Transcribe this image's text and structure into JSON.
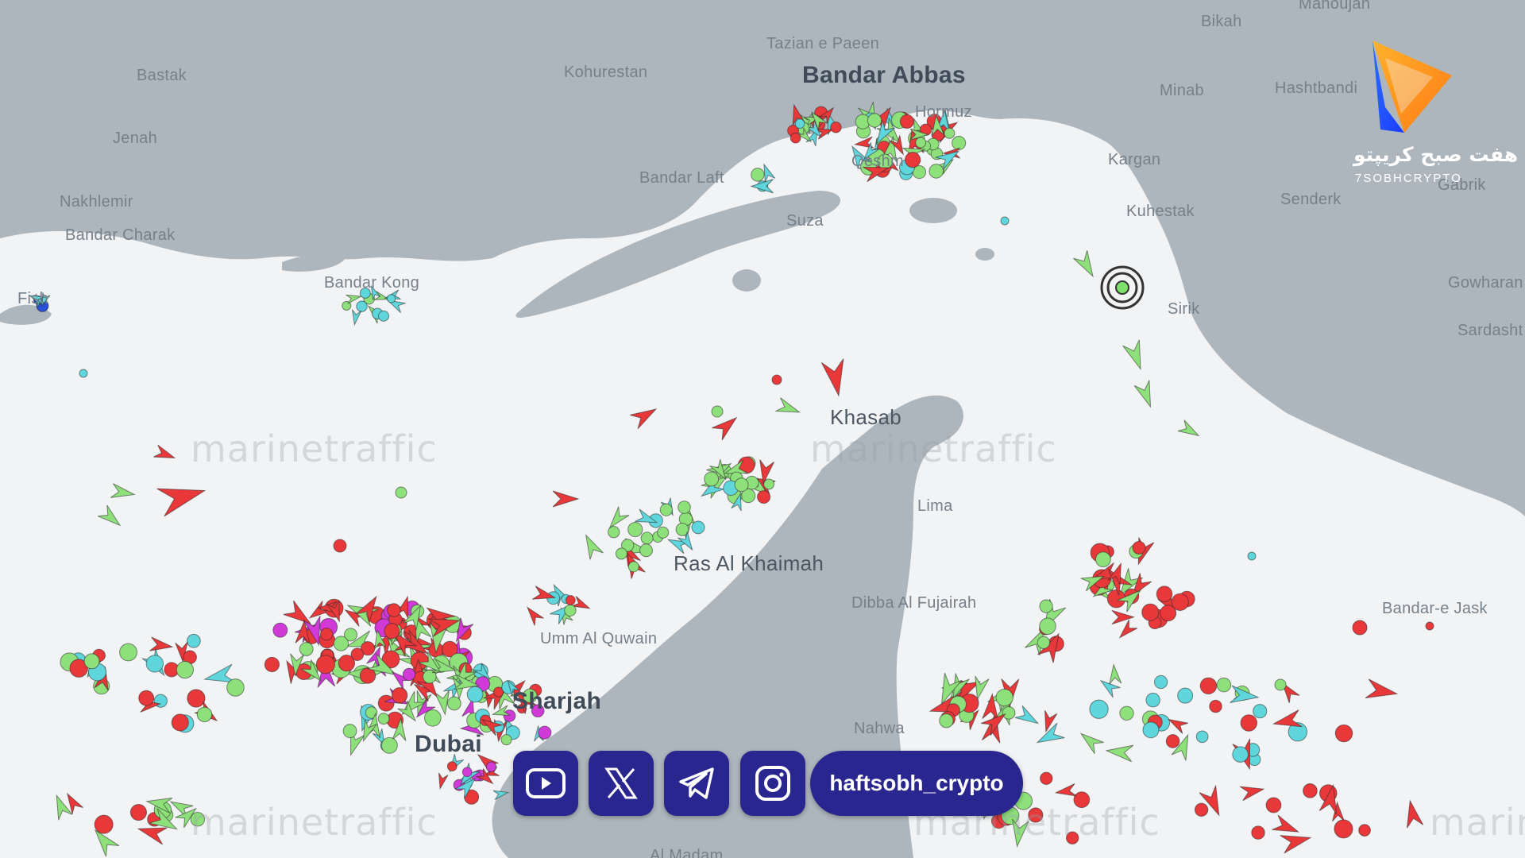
{
  "map": {
    "labels": [
      {
        "id": "bandar-abbas",
        "text": "Bandar Abbas"
      },
      {
        "id": "hormuz",
        "text": "Hormuz"
      },
      {
        "id": "tazian",
        "text": "Tazian e Paeen"
      },
      {
        "id": "kohurestan",
        "text": "Kohurestan"
      },
      {
        "id": "bastak",
        "text": "Bastak"
      },
      {
        "id": "jenah",
        "text": "Jenah"
      },
      {
        "id": "nakhlemir",
        "text": "Nakhlemir"
      },
      {
        "id": "bandar-charak",
        "text": "Bandar Charak"
      },
      {
        "id": "bandar-kong",
        "text": "Bandar Kong"
      },
      {
        "id": "bandar-laft",
        "text": "Bandar Laft"
      },
      {
        "id": "suza",
        "text": "Suza"
      },
      {
        "id": "qeshm",
        "text": "Qeshm"
      },
      {
        "id": "fish",
        "text": "Fish"
      },
      {
        "id": "khasab",
        "text": "Khasab"
      },
      {
        "id": "lima",
        "text": "Lima"
      },
      {
        "id": "ras-al-khaimah",
        "text": "Ras Al Khaimah"
      },
      {
        "id": "dibba",
        "text": "Dibba Al Fujairah"
      },
      {
        "id": "umm-al-quwain",
        "text": "Umm Al Quwain"
      },
      {
        "id": "sharjah",
        "text": "Sharjah"
      },
      {
        "id": "dubai",
        "text": "Dubai"
      },
      {
        "id": "nahwa",
        "text": "Nahwa"
      },
      {
        "id": "al-madam",
        "text": "Al Madam"
      },
      {
        "id": "bikah",
        "text": "Bikah"
      },
      {
        "id": "manoujan",
        "text": "Manoujan"
      },
      {
        "id": "minab",
        "text": "Minab"
      },
      {
        "id": "hashtbandi",
        "text": "Hashtbandi"
      },
      {
        "id": "kargan",
        "text": "Kargan"
      },
      {
        "id": "kuhestak",
        "text": "Kuhestak"
      },
      {
        "id": "senderk",
        "text": "Senderk"
      },
      {
        "id": "gabrik",
        "text": "Gabrik"
      },
      {
        "id": "sirik",
        "text": "Sirik"
      },
      {
        "id": "gowharan",
        "text": "Gowharan"
      },
      {
        "id": "sardasht",
        "text": "Sardasht"
      },
      {
        "id": "bandar-e-jask",
        "text": "Bandar-e Jask"
      }
    ],
    "watermark": "marinetraffic",
    "colors": {
      "land": "#aeb6bd",
      "sea": "#f2f3f4",
      "cargo": "#8ee07a",
      "tanker": "#e8383a",
      "passenger": "#5fd6dc",
      "pleasure": "#d23ad8"
    }
  },
  "brand": {
    "name_fa": "هفت صبح کریپتو",
    "name_en": "7SOBHCRYPTO",
    "handle": "haftsobh_crypto",
    "social": [
      "youtube-icon",
      "x-icon",
      "telegram-icon",
      "instagram-icon"
    ]
  }
}
